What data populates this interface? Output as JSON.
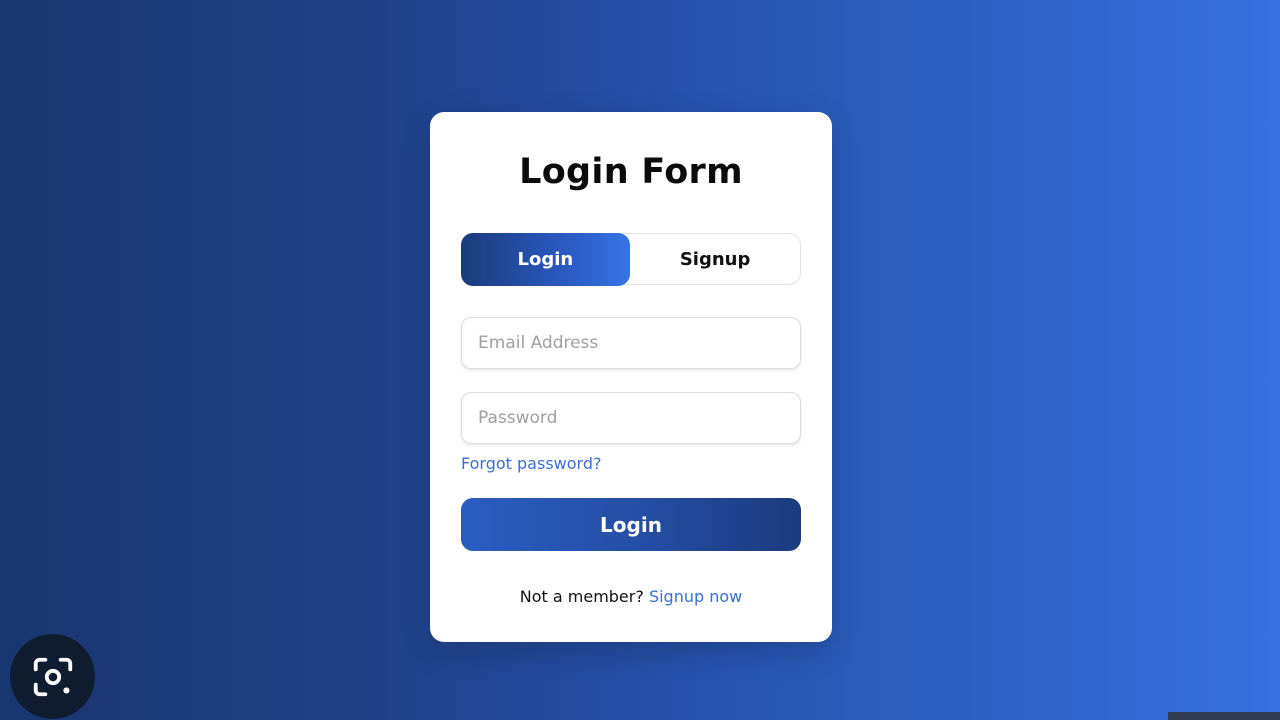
{
  "form": {
    "title": "Login Form",
    "tabs": [
      {
        "label": "Login",
        "active": true
      },
      {
        "label": "Signup",
        "active": false
      }
    ],
    "email_placeholder": "Email Address",
    "password_placeholder": "Password",
    "forgot_label": "Forgot password?",
    "submit_label": "Login",
    "footer_text": "Not a member?",
    "footer_link": "Signup now"
  },
  "overlay": {
    "lens_icon": "camera-lens-search-icon"
  },
  "colors": {
    "accent": "#3a6fd8",
    "background_dark": "#1a3670",
    "background_light": "#3770e0",
    "button": "#244ea4"
  }
}
